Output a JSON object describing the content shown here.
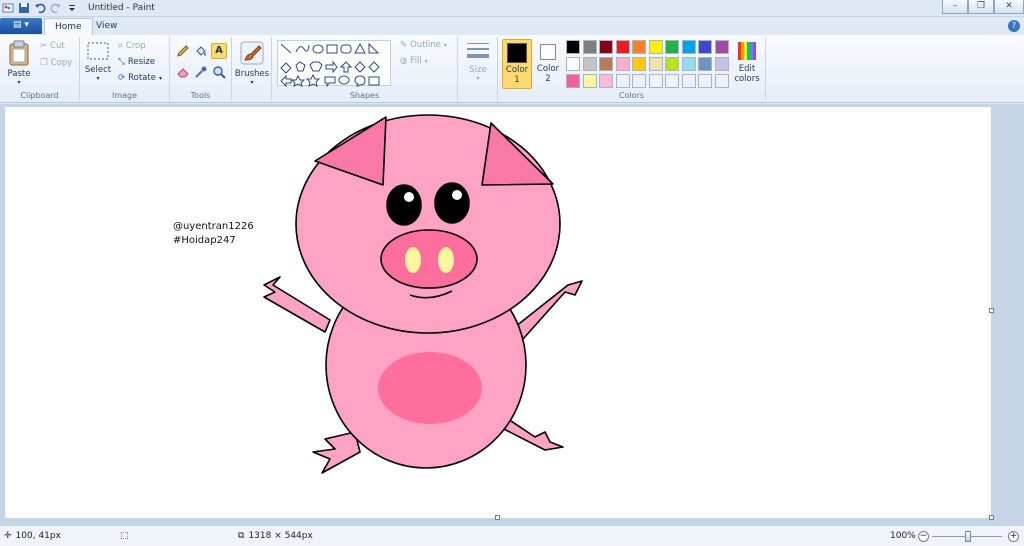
{
  "window": {
    "title": "Untitled - Paint",
    "minimize": "–",
    "maximize": "❐",
    "close": "✕"
  },
  "tabs": {
    "file": "▤ ▾",
    "home": "Home",
    "view": "View",
    "help": "?"
  },
  "ribbon": {
    "clipboard": {
      "label": "Clipboard",
      "paste": "Paste",
      "cut": "Cut",
      "copy": "Copy"
    },
    "image": {
      "label": "Image",
      "select": "Select",
      "crop": "Crop",
      "resize": "Resize",
      "rotate": "Rotate"
    },
    "tools": {
      "label": "Tools"
    },
    "brushes": {
      "label": "Brushes"
    },
    "shapes": {
      "label": "Shapes",
      "outline": "Outline",
      "fill": "Fill"
    },
    "size": {
      "label": "Size"
    },
    "colors": {
      "label": "Colors",
      "color1_label": "Color",
      "color1_num": "1",
      "color2_label": "Color",
      "color2_num": "2",
      "edit_label": "Edit",
      "edit_label2": "colors",
      "color1": "#000000",
      "color2": "#ffffff",
      "palette_row1": [
        "#000000",
        "#7f7f7f",
        "#880015",
        "#ed1c24",
        "#ff7f27",
        "#fff200",
        "#22b14c",
        "#00a2e8",
        "#3f48cc",
        "#a349a4"
      ],
      "palette_row2": [
        "#ffffff",
        "#c3c3c3",
        "#b97a57",
        "#ffaec9",
        "#ffc90e",
        "#efe4b0",
        "#b5e61d",
        "#99d9ea",
        "#7092be",
        "#c8bfe7"
      ],
      "palette_row3": [
        "#f06292",
        "#fff59d",
        "#f8bbd0",
        "#eef2f8",
        "#eef2f8",
        "#eef2f8",
        "#eef2f8",
        "#eef2f8",
        "#eef2f8",
        "#eef2f8"
      ]
    }
  },
  "canvas": {
    "watermark_line1": "@uyentran1226",
    "watermark_line2": "#Hoidap247",
    "pig_colors": {
      "body": "#ffa3c4",
      "ears": "#f878a8",
      "belly": "#ff6e9c",
      "nostril": "#fff59d"
    }
  },
  "status": {
    "cursor": "100, 41px",
    "size": "1318 × 544px",
    "zoom": "100%"
  }
}
